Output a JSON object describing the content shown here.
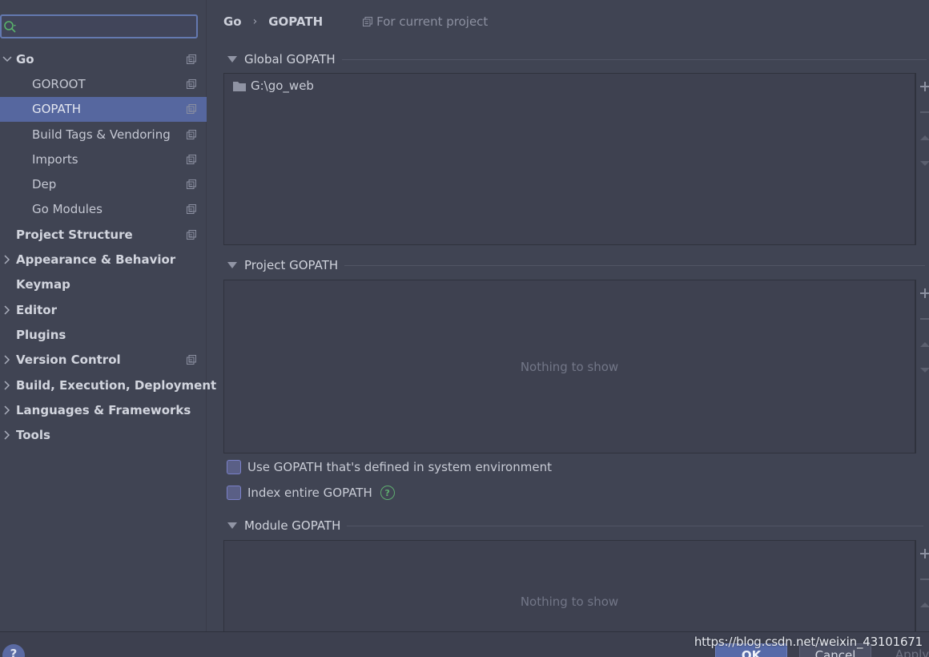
{
  "search": {
    "value": "",
    "placeholder": ""
  },
  "sidebar": {
    "items": [
      {
        "label": "Go",
        "level": "top",
        "expanded": true,
        "arrow": "expanded",
        "copy": true
      },
      {
        "label": "GOROOT",
        "level": "child",
        "copy": true
      },
      {
        "label": "GOPATH",
        "level": "child",
        "copy": true,
        "selected": true
      },
      {
        "label": "Build Tags & Vendoring",
        "level": "child",
        "copy": true
      },
      {
        "label": "Imports",
        "level": "child",
        "copy": true
      },
      {
        "label": "Dep",
        "level": "child",
        "copy": true
      },
      {
        "label": "Go Modules",
        "level": "child",
        "copy": true
      },
      {
        "label": "Project Structure",
        "level": "top",
        "copy": true
      },
      {
        "label": "Appearance & Behavior",
        "level": "top",
        "arrow": "collapsed"
      },
      {
        "label": "Keymap",
        "level": "top"
      },
      {
        "label": "Editor",
        "level": "top",
        "arrow": "collapsed"
      },
      {
        "label": "Plugins",
        "level": "top"
      },
      {
        "label": "Version Control",
        "level": "top",
        "arrow": "collapsed",
        "copy": true
      },
      {
        "label": "Build, Execution, Deployment",
        "level": "top",
        "arrow": "collapsed"
      },
      {
        "label": "Languages & Frameworks",
        "level": "top",
        "arrow": "collapsed"
      },
      {
        "label": "Tools",
        "level": "top",
        "arrow": "collapsed"
      }
    ]
  },
  "breadcrumb": {
    "parent": "Go",
    "current": "GOPATH",
    "scope": "For current project"
  },
  "global": {
    "title": "Global GOPATH",
    "paths": [
      "G:\\go_web"
    ]
  },
  "project": {
    "title": "Project GOPATH",
    "empty": "Nothing to show"
  },
  "options": {
    "use_env": "Use GOPATH that's defined in system environment",
    "index_entire": "Index entire GOPATH"
  },
  "module": {
    "title": "Module GOPATH",
    "empty": "Nothing to show"
  },
  "footer": {
    "help": "?",
    "ok": "OK",
    "cancel": "Cancel",
    "apply": "Apply",
    "watermark": "https://blog.csdn.net/weixin_43101671"
  },
  "colors": {
    "background": "#404453",
    "selection": "#56679f",
    "accent": "#6479b0",
    "help_green": "#5fae70"
  }
}
